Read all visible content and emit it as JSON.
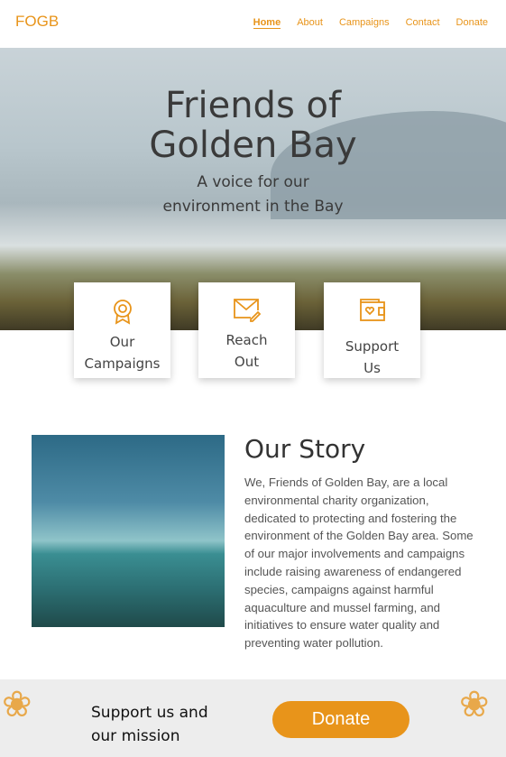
{
  "nav": {
    "logo": "FOGB",
    "links": [
      "Home",
      "About",
      "Campaigns",
      "Contact",
      "Donate"
    ]
  },
  "hero": {
    "title_line1": "Friends of",
    "title_line2": "Golden Bay",
    "subtitle_line1": "A voice for our",
    "subtitle_line2": "environment in the Bay"
  },
  "cards": [
    {
      "line1": "Our",
      "line2": "Campaigns",
      "icon": "award-icon"
    },
    {
      "line1": "Reach",
      "line2": "Out",
      "icon": "mail-edit-icon"
    },
    {
      "line1": "Support",
      "line2": "Us",
      "icon": "wallet-heart-icon"
    }
  ],
  "story": {
    "title": "Our Story",
    "text": "We, Friends of Golden Bay, are a local environmental charity organization, dedicated to protecting and fostering the environment of the Golden Bay area. Some of our major involvements and campaigns include raising awareness of endangered species, campaigns against harmful aquaculture and mussel farming, and initiatives to ensure water quality and preventing water pollution."
  },
  "footer": {
    "line1": "Support us and",
    "line2": "our mission",
    "donate": "Donate"
  },
  "colors": {
    "accent": "#e8941a"
  }
}
